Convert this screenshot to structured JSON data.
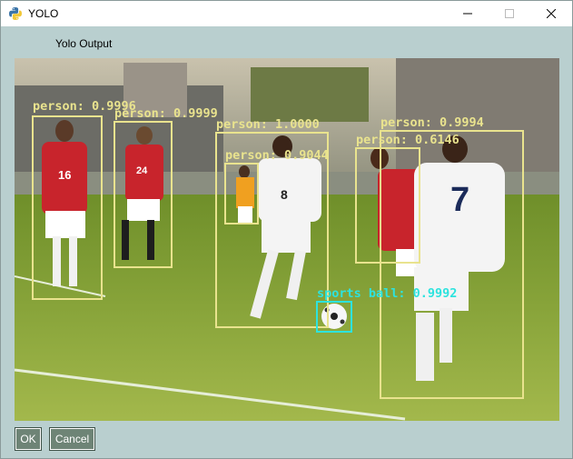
{
  "window": {
    "title": "YOLO",
    "caption": "Yolo Output"
  },
  "controls": {
    "minimize_icon": "minimize-icon",
    "maximize_icon": "maximize-icon",
    "close_icon": "close-icon"
  },
  "detections": [
    {
      "label": "person: 0.9996",
      "class": "person"
    },
    {
      "label": "person: 0.9999",
      "class": "person"
    },
    {
      "label": "person: 1.0000",
      "class": "person"
    },
    {
      "label": "person: 0.9044",
      "class": "person"
    },
    {
      "label": "person: 0.9994",
      "class": "person"
    },
    {
      "label": "person: 0.6146",
      "class": "person"
    },
    {
      "label": "sports ball: 0.9992",
      "class": "sports ball"
    }
  ],
  "players": {
    "jersey_numbers": [
      "16",
      "24",
      "8",
      "7"
    ]
  },
  "colors": {
    "person_box": "#e9e38e",
    "ball_box": "#2de3de",
    "window_bg": "#b9cfcf",
    "button_bg": "#6e8476"
  },
  "buttons": {
    "ok": "OK",
    "cancel": "Cancel"
  }
}
